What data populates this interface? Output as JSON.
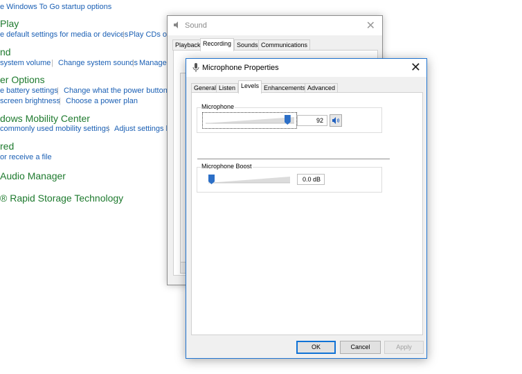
{
  "control_panel": {
    "lines": [
      {
        "text": "e Windows To Go startup options",
        "kind": "link"
      },
      {
        "text": "Play",
        "kind": "heading"
      },
      {
        "text": "e default settings for media or devices",
        "kind": "link"
      },
      {
        "text": "Play CDs or o",
        "kind": "link"
      },
      {
        "text": "nd",
        "kind": "heading"
      },
      {
        "text": "system volume",
        "kind": "link"
      },
      {
        "text": "Change system sounds",
        "kind": "link"
      },
      {
        "text": "Manage a",
        "kind": "link"
      },
      {
        "text": "er Options",
        "kind": "heading"
      },
      {
        "text": "e battery settings",
        "kind": "link"
      },
      {
        "text": "Change what the power buttons d",
        "kind": "link"
      },
      {
        "text": "screen brightness",
        "kind": "link"
      },
      {
        "text": "Choose a power plan",
        "kind": "link"
      },
      {
        "text": "dows Mobility Center",
        "kind": "heading"
      },
      {
        "text": "commonly used mobility settings",
        "kind": "link"
      },
      {
        "text": "Adjust settings be",
        "kind": "link"
      },
      {
        "text": "red",
        "kind": "heading"
      },
      {
        "text": "or receive a file",
        "kind": "link"
      },
      {
        "text": "Audio Manager",
        "kind": "heading"
      },
      {
        "text": "® Rapid Storage Technology",
        "kind": "heading"
      }
    ],
    "separator": "|"
  },
  "sound_window": {
    "title": "Sound",
    "icon": "speaker-icon",
    "close_glyph": "✕",
    "tabs": [
      {
        "label": "Playback",
        "active": false
      },
      {
        "label": "Recording",
        "active": true
      },
      {
        "label": "Sounds",
        "active": false
      },
      {
        "label": "Communications",
        "active": false
      }
    ]
  },
  "mic_window": {
    "title": "Microphone Properties",
    "icon": "microphone-icon",
    "close_glyph": "✕",
    "tabs": [
      {
        "label": "General",
        "active": false
      },
      {
        "label": "Listen",
        "active": false
      },
      {
        "label": "Levels",
        "active": true
      },
      {
        "label": "Enhancements",
        "active": false
      },
      {
        "label": "Advanced",
        "active": false
      }
    ],
    "microphone": {
      "label": "Microphone",
      "level": 92,
      "level_text": "92",
      "slider_fraction": 0.92
    },
    "boost": {
      "label": "Microphone Boost",
      "value_text": "0.0 dB",
      "slider_fraction": 0.0
    },
    "buttons": {
      "ok": "OK",
      "cancel": "Cancel",
      "apply": "Apply"
    }
  },
  "colors": {
    "heading_green": "#1e7a2e",
    "link_blue": "#1a5fb4",
    "accent_blue": "#2c6fc7",
    "active_border": "#1f74d1"
  }
}
